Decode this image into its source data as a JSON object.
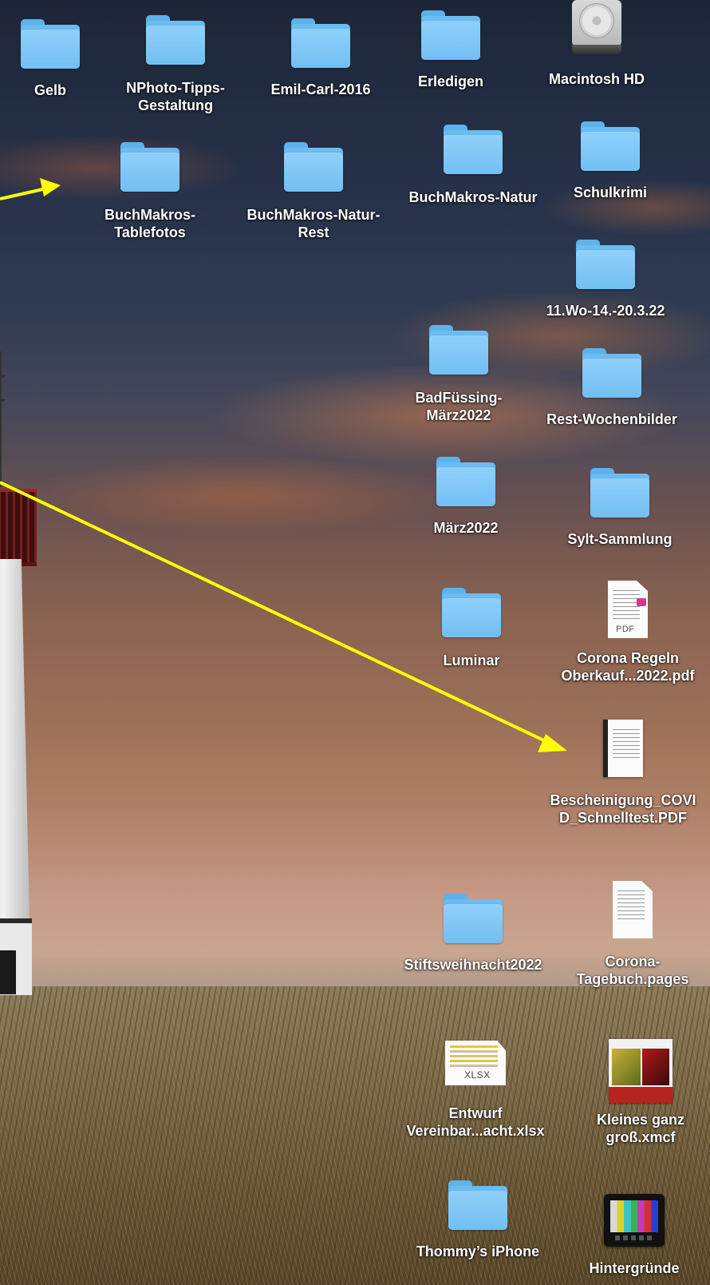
{
  "desktop": {
    "items": [
      {
        "name": "folder-gelb",
        "type": "folder",
        "line1": "Gelb",
        "line2": ""
      },
      {
        "name": "folder-nphoto-tipps-gestaltung",
        "type": "folder",
        "line1": "NPhoto-Tipps-",
        "line2": "Gestaltung"
      },
      {
        "name": "folder-emil-carl-2016",
        "type": "folder",
        "line1": "Emil-Carl-2016",
        "line2": ""
      },
      {
        "name": "folder-erledigen",
        "type": "folder",
        "line1": "Erledigen",
        "line2": ""
      },
      {
        "name": "drive-macintosh-hd",
        "type": "drive",
        "line1": "Macintosh HD",
        "line2": ""
      },
      {
        "name": "folder-buchmakros-tablefotos",
        "type": "folder",
        "line1": "BuchMakros-",
        "line2": "Tablefotos"
      },
      {
        "name": "folder-buchmakros-natur-rest",
        "type": "folder",
        "line1": "BuchMakros-Natur-",
        "line2": "Rest"
      },
      {
        "name": "folder-buchmakros-natur",
        "type": "folder",
        "line1": "BuchMakros-Natur",
        "line2": ""
      },
      {
        "name": "folder-schulkrimi",
        "type": "folder",
        "line1": "Schulkrimi",
        "line2": ""
      },
      {
        "name": "folder-11-wo",
        "type": "folder",
        "line1": "11.Wo-14.-20.3.22",
        "line2": ""
      },
      {
        "name": "folder-badfuessing-maerz2022",
        "type": "folder",
        "line1": "BadFüssing-",
        "line2": "März2022"
      },
      {
        "name": "folder-rest-wochenbilder",
        "type": "folder",
        "line1": "Rest-Wochenbilder",
        "line2": ""
      },
      {
        "name": "folder-maerz2022",
        "type": "folder",
        "line1": "März2022",
        "line2": ""
      },
      {
        "name": "folder-sylt-sammlung",
        "type": "folder",
        "line1": "Sylt-Sammlung",
        "line2": ""
      },
      {
        "name": "folder-luminar",
        "type": "folder",
        "line1": "Luminar",
        "line2": ""
      },
      {
        "name": "file-corona-regeln-pdf",
        "type": "pdf",
        "line1": "Corona Regeln",
        "line2": "Oberkauf...2022.pdf",
        "badge": "PDF"
      },
      {
        "name": "file-bescheinigung-covid-pdf",
        "type": "scan",
        "line1": "Bescheinigung_COVI",
        "line2": "D_Schnelltest.PDF"
      },
      {
        "name": "folder-stiftsweihnacht2022",
        "type": "folder",
        "line1": "Stiftsweihnacht2022",
        "line2": ""
      },
      {
        "name": "file-corona-tagebuch-pages",
        "type": "pages",
        "line1": "Corona-",
        "line2": "Tagebuch.pages"
      },
      {
        "name": "file-entwurf-xlsx",
        "type": "xlsx",
        "line1": "Entwurf",
        "line2": "Vereinbar...acht.xlsx",
        "badge": "XLSX"
      },
      {
        "name": "file-kleines-ganz-gross-xmcf",
        "type": "xmcf",
        "line1": "Kleines ganz",
        "line2": "groß.xmcf"
      },
      {
        "name": "folder-thommys-iphone",
        "type": "folder",
        "line1": "Thommy’s iPhone",
        "line2": ""
      },
      {
        "name": "app-hintergruende",
        "type": "tv",
        "line1": "Hintergründe",
        "line2": ""
      }
    ]
  },
  "colors": {
    "arrow": "#ffff00",
    "folder": "#7cc4f4",
    "label": "#ffffff"
  }
}
